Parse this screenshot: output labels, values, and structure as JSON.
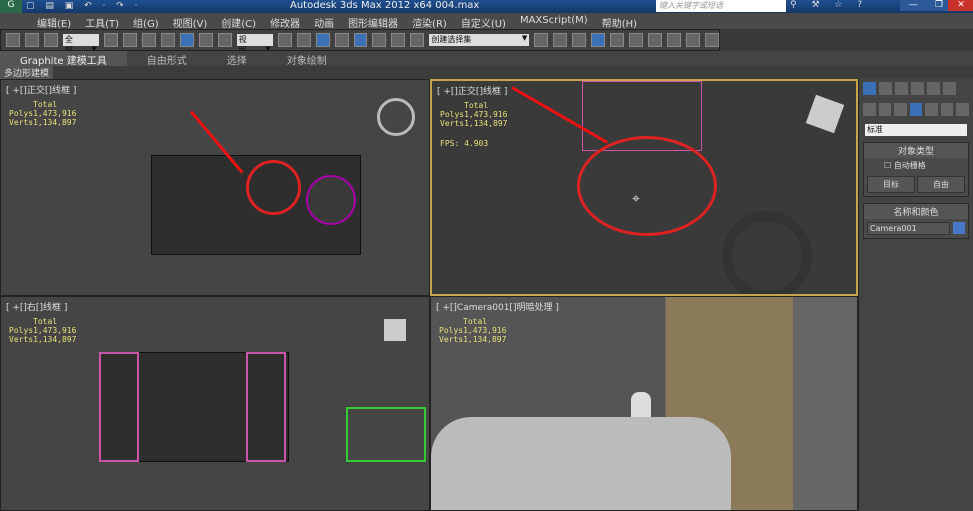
{
  "title": {
    "app_icon": "3ds-max-logo",
    "quick_access": "▢ ▤ ▣ ↶ · ↷ ·",
    "text": "Autodesk 3ds Max  2012 x64     004.max",
    "search_placeholder": "键入关键字或短语",
    "help": "?",
    "minimize": "—",
    "restore": "❐",
    "close": "✕"
  },
  "menu": [
    "编辑(E)",
    "工具(T)",
    "组(G)",
    "视图(V)",
    "创建(C)",
    "修改器",
    "动画",
    "图形编辑器",
    "渲染(R)",
    "自定义(U)",
    "MAXScript(M)",
    "帮助(H)"
  ],
  "toolbar": {
    "selection_filter": "全部",
    "ref_coord": "视图",
    "named_selection": "创建选择集"
  },
  "ribbon": {
    "tabs": [
      "Graphite 建模工具",
      "自由形式",
      "选择",
      "对象绘制"
    ],
    "sub": "多边形建模"
  },
  "viewports": [
    {
      "label": "[ +[]正交[]线框 ]",
      "total": "Total",
      "polys": "Polys1,473,916",
      "verts": "Verts1,134,897"
    },
    {
      "label": "[ +[]正交[]线框 ]",
      "total": "Total",
      "polys": "Polys1,473,916",
      "verts": "Verts1,134,897",
      "fps": "FPS: 4.903"
    },
    {
      "label": "[ +[]右[]线框 ]",
      "total": "Total",
      "polys": "Polys1,473,916",
      "verts": "Verts1,134,897"
    },
    {
      "label": "[ +[]Camera001[]明暗处理 ]",
      "total": "Total",
      "polys": "Polys1,473,916",
      "verts": "Verts1,134,897"
    }
  ],
  "command_panel": {
    "category": "标准",
    "object_type_header": "对象类型",
    "autogrid": "自动栅格",
    "btn_target": "目标",
    "btn_free": "自由",
    "name_color_header": "名称和颜色",
    "object_name": "Camera001",
    "color": "#4a78c8"
  }
}
